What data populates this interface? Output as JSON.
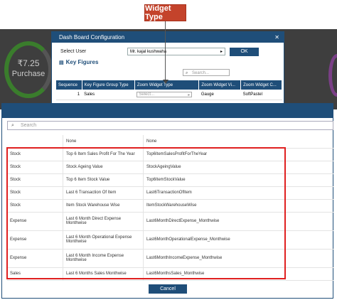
{
  "callout": {
    "label": "Widget Type"
  },
  "background": {
    "amount": "₹7.25",
    "label": "Purchase"
  },
  "config_dialog": {
    "title": "Dash Board Configuration",
    "select_user_label": "Select User",
    "selected_user": "Mr. kajal kushwaha",
    "ok_label": "OK",
    "key_figures_label": "Key Figures",
    "search_placeholder": "Search...",
    "columns": [
      "Sequence",
      "Key Figure Group Type",
      "Zoom Widget Type",
      "Zoom Widget Vi...",
      "Zoom Widget C..."
    ],
    "rows": [
      {
        "sequence": "1",
        "group_type": "Sales",
        "widget_type": "Select...",
        "visual": "Gauge",
        "color": "SoftPastel"
      }
    ]
  },
  "widget_dialog": {
    "search_placeholder": "Search",
    "rows": [
      {
        "category": "",
        "name": "None",
        "code": "None"
      },
      {
        "category": "Stock",
        "name": "Top 6 Item Sales Profit For The Year",
        "code": "Top6ItemSalesProfitForTheYear"
      },
      {
        "category": "Stock",
        "name": "Stock Ageing Value",
        "code": "StockAgeingValue"
      },
      {
        "category": "Stock",
        "name": "Top 6 Item Stock Value",
        "code": "Top6ItemStockValue"
      },
      {
        "category": "Stock",
        "name": "Last 6 Transaction Of Item",
        "code": "Last6TransactionOfItem"
      },
      {
        "category": "Stock",
        "name": "Item Stock Warehouse Wise",
        "code": "ItemStockWarehouseWise"
      },
      {
        "category": "Expense",
        "name": "Last 6 Month Direct Expense Monthwise",
        "code": "Last6MonthDirectExpense_Monthwise"
      },
      {
        "category": "Expense",
        "name": "Last 6 Month Operational Expense Monthwise",
        "code": "Last6MonthOperationalExpense_Monthwise"
      },
      {
        "category": "Expense",
        "name": "Last 6 Month Income Expense Monthwise",
        "code": "Last6MonthIncomeExpense_Monthwise"
      },
      {
        "category": "Sales",
        "name": "Last 6 Months Sales Monthwise",
        "code": "Last6MonthsSales_Monthwise"
      }
    ],
    "cancel_label": "Cancel"
  },
  "colors": {
    "header": "#1f4e79",
    "highlight": "#e02020",
    "callout": "#c4432b"
  }
}
